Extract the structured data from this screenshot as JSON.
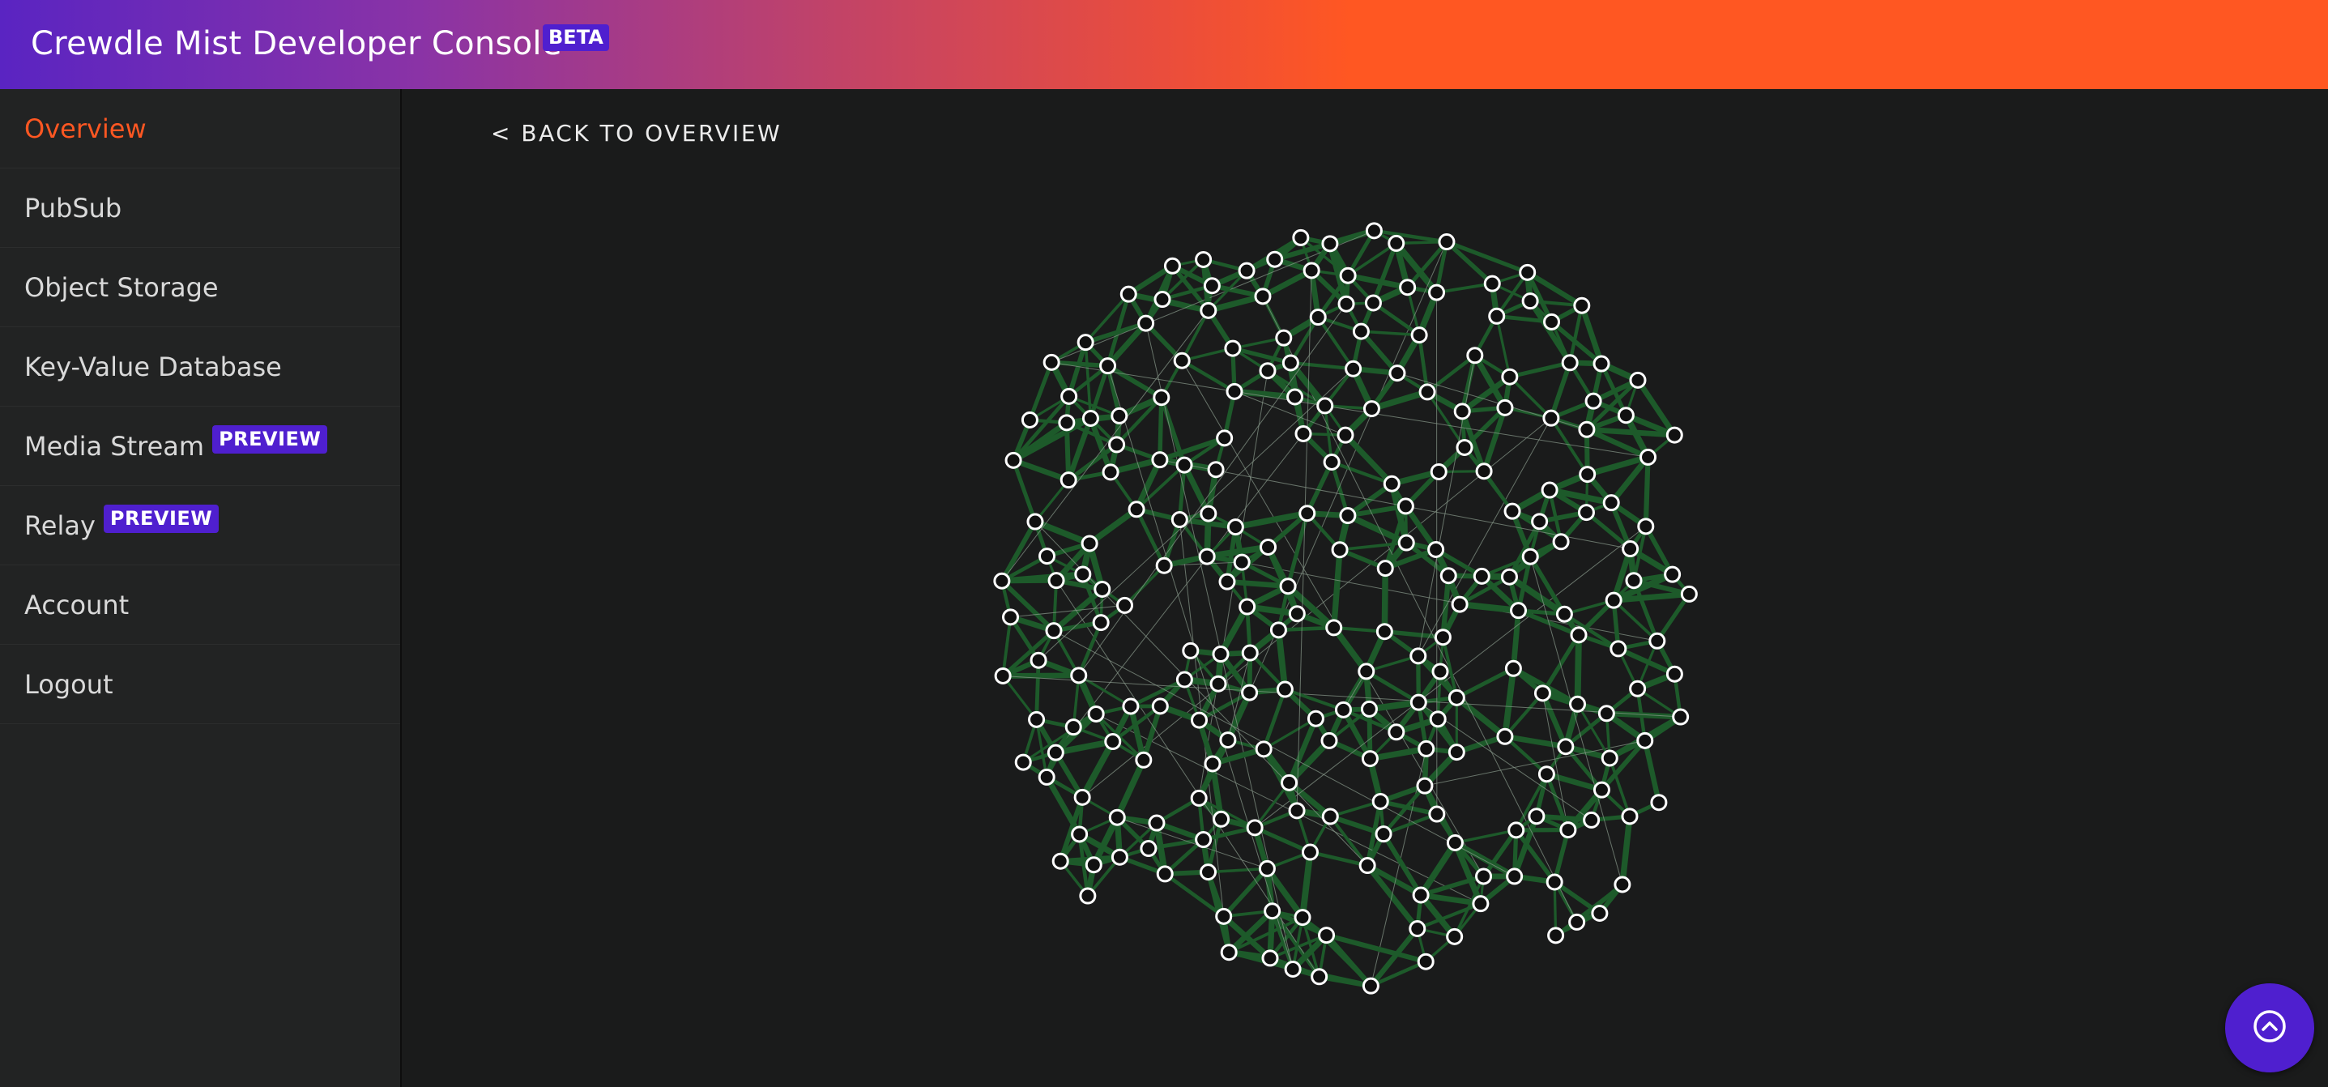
{
  "header": {
    "title": "Crewdle Mist Developer Console",
    "badge": "BETA"
  },
  "sidebar": {
    "items": [
      {
        "label": "Overview",
        "active": true
      },
      {
        "label": "PubSub"
      },
      {
        "label": "Object Storage"
      },
      {
        "label": "Key-Value Database"
      },
      {
        "label": "Media Stream",
        "badge": "PREVIEW"
      },
      {
        "label": "Relay",
        "badge": "PREVIEW"
      },
      {
        "label": "Account"
      },
      {
        "label": "Logout"
      }
    ]
  },
  "main": {
    "back_link": "< BACK TO OVERVIEW"
  },
  "network_graph": {
    "node_count": 240,
    "edge_color": "#1d5a2a",
    "node_fill": "#111111",
    "node_stroke": "#ffffff"
  },
  "fab": {
    "icon": "chevron-up-icon"
  },
  "colors": {
    "accent": "#ff5722",
    "badge": "#4f1fcf",
    "background": "#1a1b1b",
    "sidebar": "#222323"
  }
}
